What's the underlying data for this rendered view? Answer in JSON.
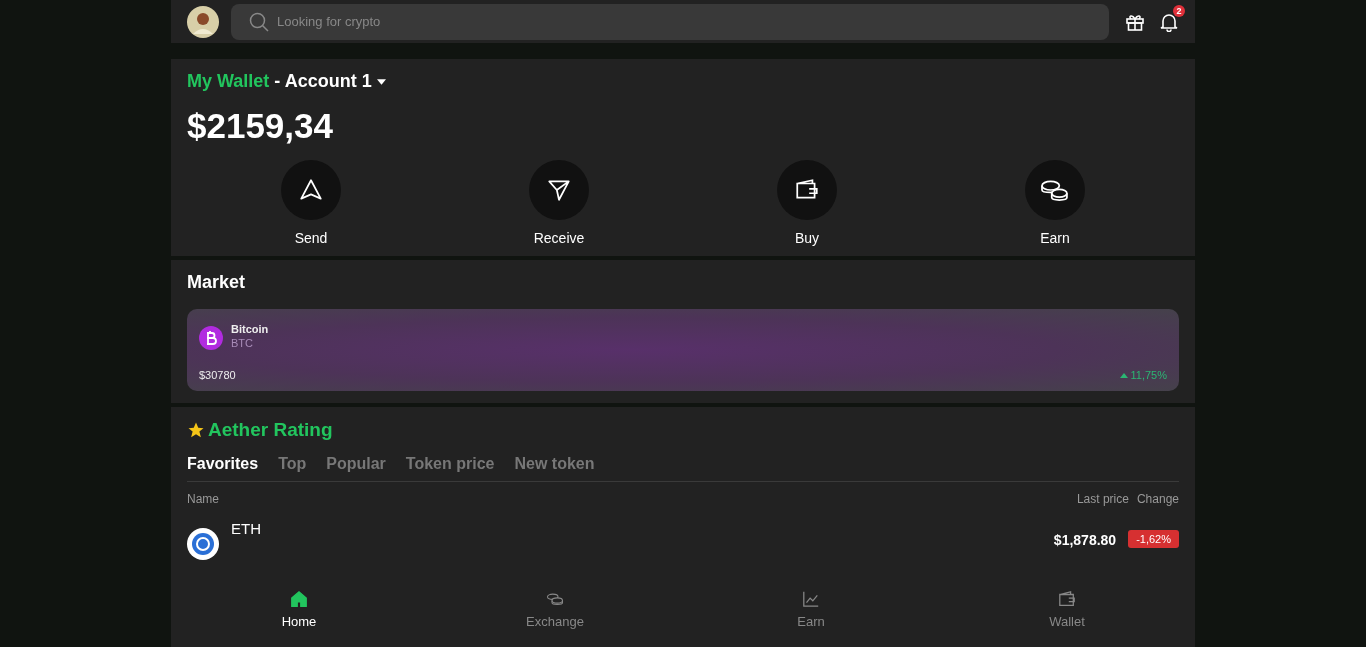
{
  "search": {
    "placeholder": "Looking for crypto"
  },
  "notifications": {
    "count": "2"
  },
  "wallet": {
    "title": "My Wallet",
    "account": "- Account 1",
    "balance": "$2159,34",
    "actions": [
      {
        "kind": "send",
        "label": "Send"
      },
      {
        "kind": "receive",
        "label": "Receive"
      },
      {
        "kind": "buy",
        "label": "Buy"
      },
      {
        "kind": "earn",
        "label": "Earn"
      }
    ]
  },
  "market": {
    "title": "Market",
    "coins": [
      {
        "name": "Bitcoin",
        "symbol": "BTC",
        "price": "$30780",
        "change": "11,75%",
        "up": true
      }
    ]
  },
  "rating": {
    "title": "Aether Rating",
    "tabs": [
      {
        "label": "Favorites",
        "selected": true
      },
      {
        "label": "Top",
        "selected": false
      },
      {
        "label": "Popular",
        "selected": false
      },
      {
        "label": "Token price",
        "selected": false
      },
      {
        "label": "New token",
        "selected": false
      }
    ],
    "columns": [
      "Name",
      "Last price",
      "Change"
    ],
    "rows": [
      {
        "name": "ETH",
        "price": "$1,878.80",
        "change": "-1,62%",
        "up": false
      }
    ]
  },
  "nav": [
    {
      "kind": "home",
      "label": "Home",
      "selected": true
    },
    {
      "kind": "exchange",
      "label": "Exchange",
      "selected": false
    },
    {
      "kind": "earn",
      "label": "Earn",
      "selected": false
    },
    {
      "kind": "wallet",
      "label": "Wallet",
      "selected": false
    }
  ]
}
